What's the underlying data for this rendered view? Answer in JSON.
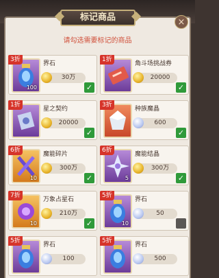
{
  "dialog": {
    "title": "标记商品",
    "close_glyph": "×",
    "subtitle": "请勾选需要标记的商品"
  },
  "items": [
    {
      "discount": "3折",
      "name": "界石",
      "icon": "soul-stone-icon",
      "count": "100",
      "currency": "gold-coin",
      "price": "30万",
      "checked": true
    },
    {
      "discount": "1折",
      "name": "角斗场挑战券",
      "icon": "arena-ticket-icon",
      "count": "",
      "currency": "gold-coin",
      "price": "20000",
      "checked": true
    },
    {
      "discount": "1折",
      "name": "星之契约",
      "icon": "star-contract-icon",
      "count": "",
      "currency": "gold-coin",
      "price": "20000",
      "checked": true
    },
    {
      "discount": "3折",
      "name": "种族魔晶",
      "icon": "race-crystal-icon",
      "count": "",
      "currency": "diamond",
      "price": "600",
      "checked": true
    },
    {
      "discount": "6折",
      "name": "魔能碎片",
      "icon": "magic-shard-icon",
      "count": "10",
      "currency": "gold-coin",
      "price": "300万",
      "checked": true
    },
    {
      "discount": "6折",
      "name": "魔能结晶",
      "icon": "magic-crystal-icon",
      "count": "5",
      "currency": "gold-coin",
      "price": "300万",
      "checked": true
    },
    {
      "discount": "7折",
      "name": "万象占星石",
      "icon": "astrology-stone-icon",
      "count": "10",
      "currency": "gold-coin",
      "price": "210万",
      "checked": true
    },
    {
      "discount": "5折",
      "name": "界石",
      "icon": "soul-stone-icon",
      "count": "10",
      "currency": "diamond",
      "price": "50",
      "checked": false
    },
    {
      "discount": "5折",
      "name": "界石",
      "icon": "soul-stone-icon",
      "count": "",
      "currency": "diamond",
      "price": "100",
      "checked": false
    },
    {
      "discount": "5折",
      "name": "界石",
      "icon": "soul-stone-icon",
      "count": "",
      "currency": "diamond",
      "price": "500",
      "checked": false
    }
  ],
  "check_glyph": "✓",
  "colors": {
    "accent_red": "#d6342a",
    "check_green": "#2f9a3a",
    "subtitle_red": "#d0503a"
  }
}
